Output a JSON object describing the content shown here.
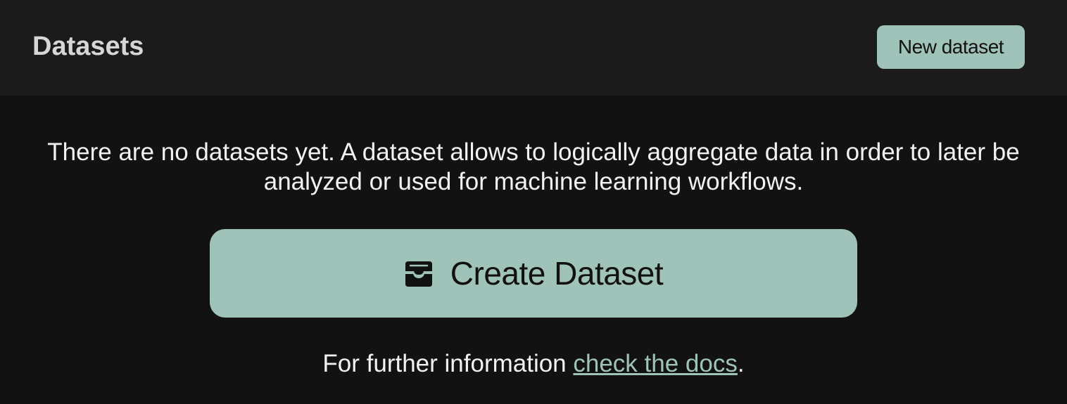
{
  "header": {
    "title": "Datasets",
    "new_button_label": "New dataset"
  },
  "main": {
    "empty_message": "There are no datasets yet. A dataset allows to logically aggregate data in order to later be analyzed or used for machine learning workflows.",
    "create_button": {
      "label": "Create Dataset",
      "icon": "inbox-tray-icon"
    },
    "footer": {
      "prefix": "For further information ",
      "link_text": "check the docs",
      "suffix": "."
    }
  },
  "colors": {
    "accent": "#9fc3b8",
    "background": "#121212",
    "header_background": "#1b1b1b"
  }
}
